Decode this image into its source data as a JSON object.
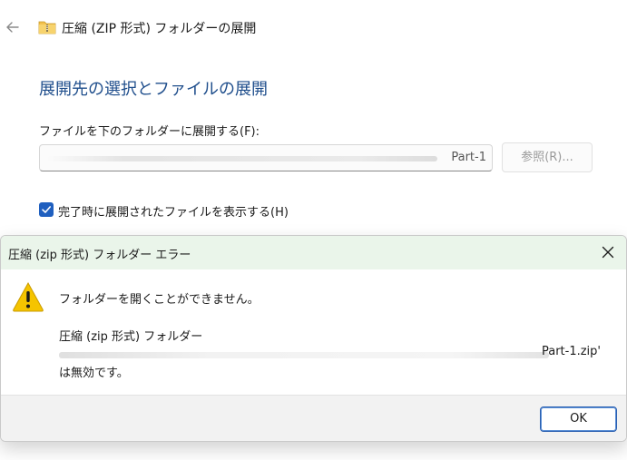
{
  "wizard": {
    "title": "圧縮 (ZIP 形式) フォルダーの展開",
    "heading": "展開先の選択とファイルの展開",
    "path_label": "ファイルを下のフォルダーに展開する(F):",
    "path_value": "Part-1",
    "browse_label": "参照(R)...",
    "checkbox_label": "完了時に展開されたファイルを表示する(H)",
    "checkbox_checked": true
  },
  "dialog": {
    "title": "圧縮 (zip 形式) フォルダー エラー",
    "message": "フォルダーを開くことができません。",
    "sub_message": "圧縮 (zip 形式) フォルダー",
    "path_value": "Part-1.zip'",
    "invalid_text": "は無効です。",
    "ok_label": "OK"
  },
  "icons": {
    "back": "arrow-left-icon",
    "folder": "zip-folder-icon",
    "warning": "warning-icon",
    "close": "close-icon",
    "check": "checkmark-icon"
  },
  "colors": {
    "accent": "#1f5fbf",
    "heading": "#1f4e8c",
    "dialog_titlebar": "#eaf5ea",
    "warning_fill": "#f5c400"
  }
}
